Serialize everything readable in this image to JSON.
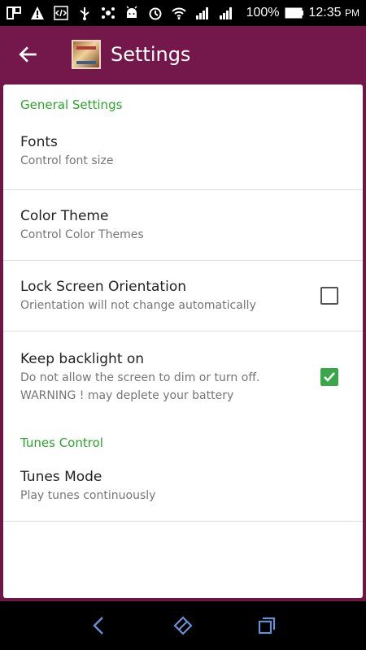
{
  "status_bar": {
    "battery": "100%",
    "time": "12:35",
    "ampm": "PM"
  },
  "app_bar": {
    "title": "Settings"
  },
  "sections": {
    "general": {
      "header": "General Settings",
      "fonts": {
        "title": "Fonts",
        "summary": "Control font size"
      },
      "color_theme": {
        "title": "Color Theme",
        "summary": "Control Color Themes"
      },
      "lock_orientation": {
        "title": "Lock Screen Orientation",
        "summary": "Orientation will not change automatically",
        "checked": false
      },
      "backlight": {
        "title": "Keep backlight on",
        "summary_line1": "Do not allow the screen to dim or turn off.",
        "summary_line2": "WARNING ! may deplete your battery",
        "checked": true
      }
    },
    "tunes": {
      "header": "Tunes Control",
      "mode": {
        "title": "Tunes Mode",
        "summary": "Play tunes continuously"
      }
    }
  },
  "colors": {
    "accent": "#74174a",
    "section_header": "#2aa52a",
    "checkbox_checked": "#39a84a"
  }
}
